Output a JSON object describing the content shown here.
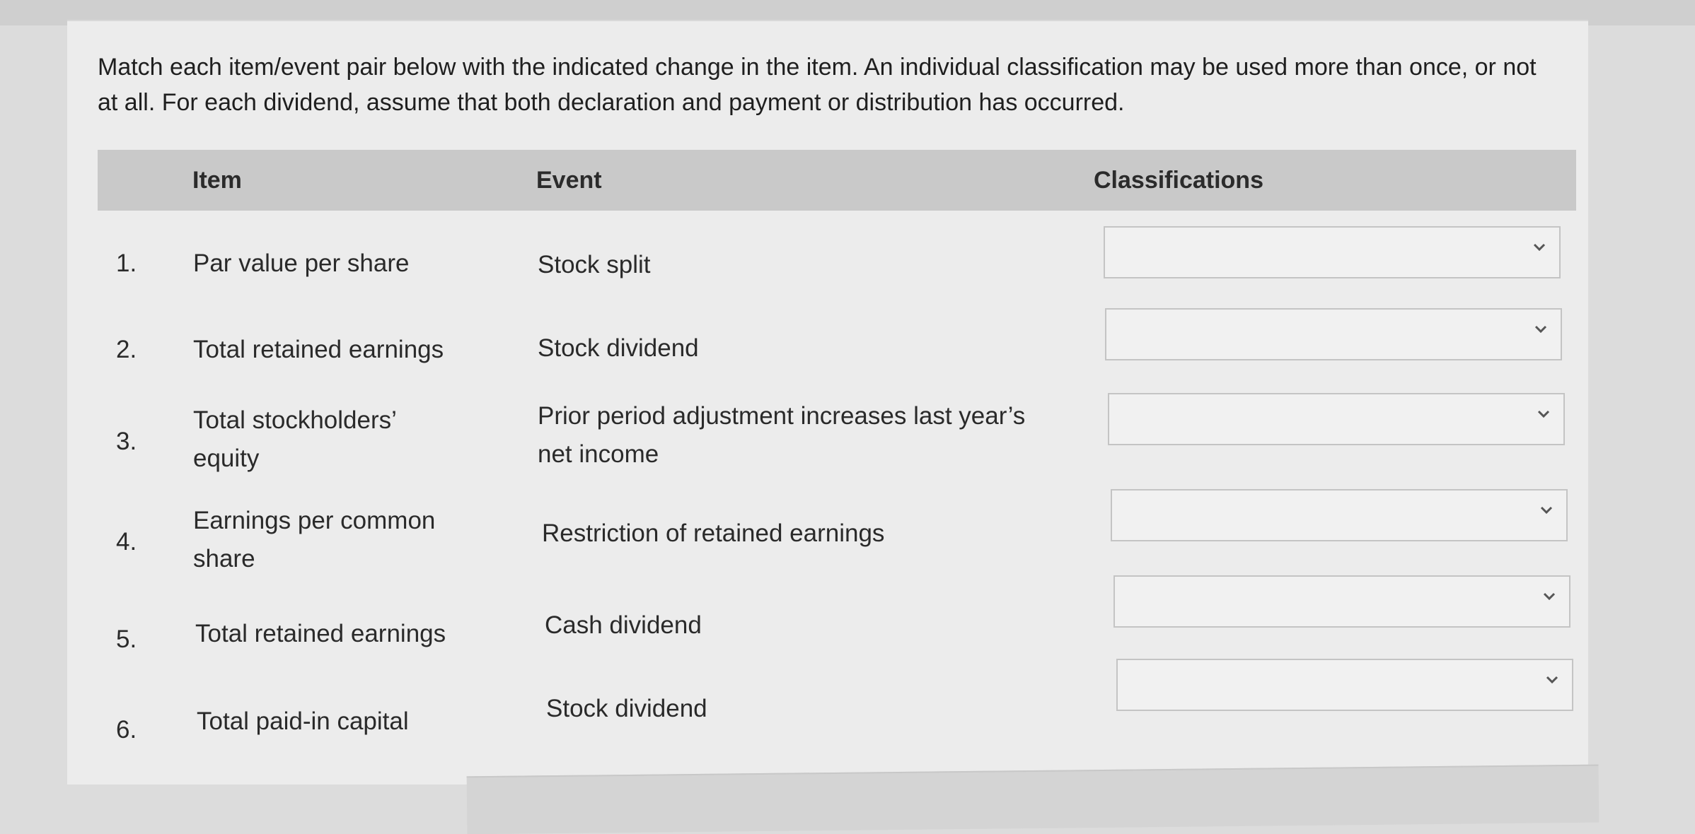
{
  "instructions": "Match each item/event pair below with the indicated change in the item. An individual classification may be used more than once, or not at all. For each dividend, assume that both declaration and payment or distribution has occurred.",
  "table": {
    "headers": {
      "item": "Item",
      "event": "Event",
      "classifications": "Classifications"
    },
    "rows": [
      {
        "num": "1.",
        "item": "Par value per share",
        "event": "Stock split",
        "selected": ""
      },
      {
        "num": "2.",
        "item": "Total retained earnings",
        "event": "Stock dividend",
        "selected": ""
      },
      {
        "num": "3.",
        "item": "Total stockholders’ equity",
        "event": "Prior period adjustment increases last year’s net income",
        "selected": ""
      },
      {
        "num": "4.",
        "item": "Earnings per common share",
        "event": "Restriction of retained earnings",
        "selected": ""
      },
      {
        "num": "5.",
        "item": "Total retained earnings",
        "event": "Cash dividend",
        "selected": ""
      },
      {
        "num": "6.",
        "item": "Total paid-in capital",
        "event": "Stock dividend",
        "selected": ""
      }
    ]
  },
  "icons": {
    "dropdown": "chevron-down-icon"
  }
}
